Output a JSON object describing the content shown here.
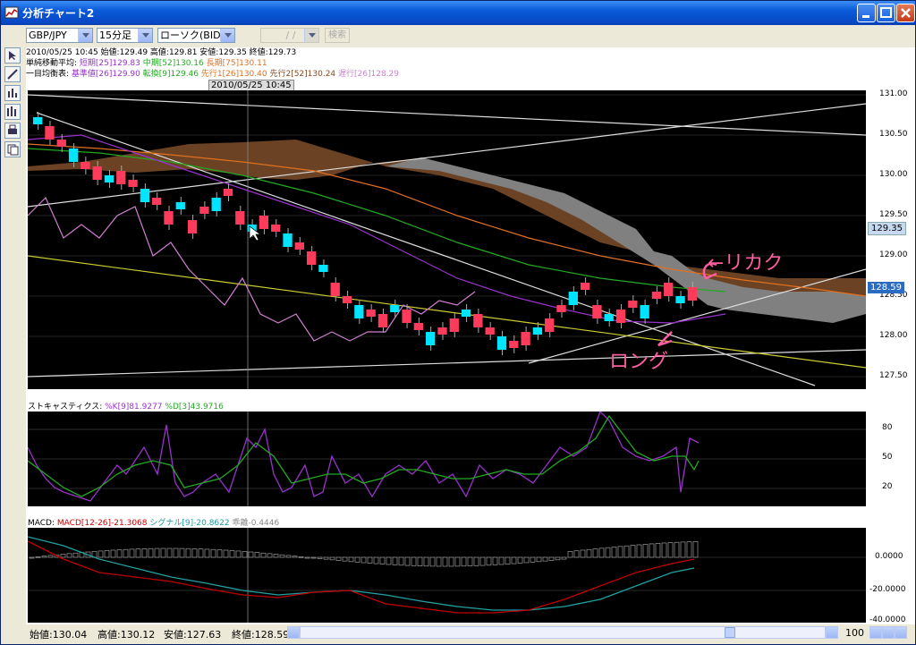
{
  "window": {
    "title": "分析チャート2"
  },
  "toolbar": {
    "pair": "GBP/JPY",
    "timeframe": "15分足",
    "chart_type": "ローソク(BID)",
    "date_placeholder": "/ /",
    "search_label": "検索"
  },
  "info": {
    "line1": "2010/05/25 10:45  始値:129.49  高値:129.81  安値:129.35  終値:129.73",
    "sma_label": "単純移動平均:",
    "sma_short": "短期[25]129.83",
    "sma_mid": "中期[52]130.16",
    "sma_long": "長期[75]130.11",
    "ichimoku_label": "一目均衡表:",
    "ichi_base": "基準値[26]129.90",
    "ichi_conv": "転換[9]129.46",
    "ichi_span1": "先行1[26]130.40",
    "ichi_span2": "先行2[52]130.24",
    "ichi_lag": "遅行[26]128.29"
  },
  "cursor_date": "2010/05/25 10:45",
  "price_axis": [
    "131.00",
    "130.50",
    "130.00",
    "129.50",
    "129.00",
    "128.50",
    "128.00",
    "127.50"
  ],
  "price_tags": {
    "current": "129.35",
    "last": "128.59"
  },
  "annotations": {
    "top": "←リカク",
    "bottom": "ロング"
  },
  "stoch": {
    "label": "ストキャスティクス:",
    "k": "%K[9]81.9277",
    "d": "%D[3]43.9716",
    "axis": [
      "80",
      "50",
      "20"
    ]
  },
  "macd": {
    "label": "MACD:",
    "macd": "MACD[12-26]-21.3068",
    "signal": "シグナル[9]-20.8622",
    "hist": "乖離-0.4446",
    "axis": [
      "0.0000",
      "-20.0000",
      "-40.0000"
    ]
  },
  "status": {
    "open": "始値:130.04",
    "high": "高値:130.12",
    "low": "安値:127.63",
    "close": "終値:128.59",
    "zoom": "100"
  },
  "colors": {
    "bull": "#00e5ff",
    "bear": "#ff3b5c",
    "cloud_up": "#7a3a12",
    "cloud_down": "#808080",
    "sma_short": "#9932cc",
    "sma_mid": "#22aa22",
    "sma_long": "#e07020",
    "lag": "#d080d0"
  }
}
